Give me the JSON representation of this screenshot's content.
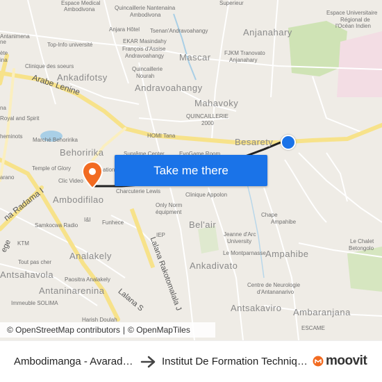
{
  "map": {
    "cta_label": "Take me there",
    "attribution": {
      "osm": "© OpenStreetMap contributors",
      "separator": "|",
      "omt": "© OpenMapTiles"
    },
    "districts": {
      "anjanahary": "Anjanahary",
      "ankadifotsy": "Ankadifotsy",
      "andravoahangy": "Andravoahangy",
      "mascar": "Mascar",
      "mahavoky": "Mahavoky",
      "besarety": "Besarety",
      "behoririka": "Behoririka",
      "ambodifilao": "Ambodifilao",
      "belair": "Bel'air",
      "ankadivato": "Ankadivato",
      "ampahibe": "Ampahibe",
      "analakely": "Analakely",
      "antsahavola": "Antsahavola",
      "antaninarenina": "Antaninarenina",
      "antsakaviro": "Antsakaviro",
      "ambaranjana": "Ambaranjana"
    },
    "roads": {
      "arabe_lenine": "Arabe Lenine",
      "radama": "na Radama I",
      "rakotomalala": "Lalana Rakotomalala J",
      "lalana_s": "Lalana S",
      "ege": "ege"
    },
    "pois": {
      "espace_medical": "Espace Medical",
      "ambodivona": "Ambodivona",
      "quincaillerie_nantenaina": "Quincaillerie Nantenaina",
      "ambodivona2": "Ambodivona",
      "superieur": "Superieur",
      "espace_universitaire": "Espace Universitaire",
      "regional": "Régional de",
      "ocean_indien": "l'Océan Indien",
      "antanimena": "Antanimena",
      "anjara_hotel": "Anjara Hôtel",
      "tsenan": "Tsenan'Andravoahangy",
      "top_info": "Top-Info université",
      "ekar": "EKAR Masindahy",
      "francois": "François d'Assise",
      "andravoahangy_poi": "Andravoahangy",
      "fjkm": "FJKM Tranovato",
      "anjanahary_poi": "Anjanahary",
      "clinique_soeurs": "Clinique des soeurs",
      "quincaillerie_nourah": "Quincaillerie",
      "nourah": "Nourah",
      "quincaillerie_2000": "QUINCAILLERIE",
      "q2000": "2000",
      "royal": "Royal and Spirit",
      "homi": "HOMI Tana",
      "marche": "Marché Behoririka",
      "supreme": "Suprême Center",
      "evogame": "EvoGame Room",
      "temple": "Temple of Glory",
      "clic": "Clic Video",
      "station": "ation",
      "charcuterie": "Charcuterie Lewis",
      "clinique_appolon": "Clinique Appolon",
      "only_norm": "Only Norm",
      "equipment": "équipment",
      "samkocwa": "Samkocwa Radio",
      "ktm": "KTM",
      "funhece": "Funhece",
      "iep": "IEP",
      "chape": "Chape",
      "ampahibe_poi": "Ampahibe",
      "jeanne": "Jeanne d'Arc",
      "university": "University",
      "montparnasse": "Le Montparnasse",
      "chalet": "Le Chalet",
      "betongolo": "Betongolo",
      "tout_pas_cher": "Tout pas cher",
      "paositra": "Paositra Analakely",
      "immeuble": "Immeuble SOLIMA",
      "centre_neuro": "Centre de Neurologie",
      "antananarivo": "d'Antananarivo",
      "escame": "ESCAME",
      "harish": "Harish Doulah",
      "ne": "ne",
      "i_and_i": "I&I",
      "chemin": "heminots",
      "arano": "arano",
      "na": "na",
      "ete": "ète",
      "ina": "ina"
    },
    "colors": {
      "cta": "#1a73e8",
      "origin": "#1a73e8",
      "destination": "#f26b21",
      "route": "#222222",
      "major_road": "#f7e28a",
      "green": "#cfe3b5"
    }
  },
  "footer": {
    "from": "Ambodimanga - Avaradoha",
    "to": "Institut De Formation Technique",
    "brand": "moovit"
  }
}
